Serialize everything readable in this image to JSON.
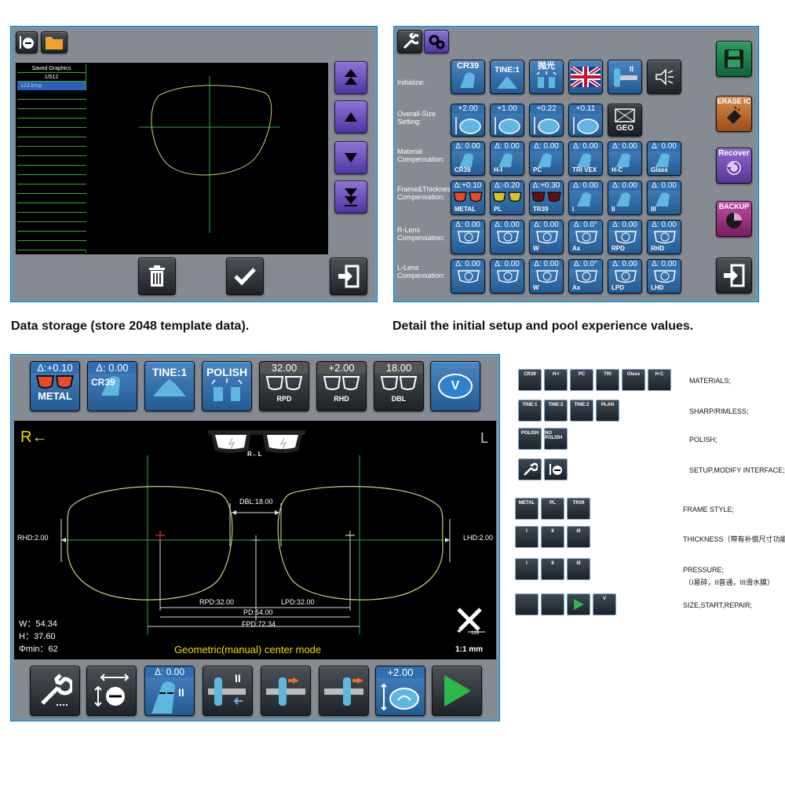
{
  "storage_panel": {
    "list_title": "Saved Graphics",
    "list_count": "1/512",
    "list_selected": "123.bmp",
    "caption": "Data storage (store 2048 template data)."
  },
  "setup_panel": {
    "caption": "Detail the initial setup and pool experience values.",
    "rows": [
      {
        "label": "Initialize:"
      },
      {
        "label": "Overall-Size Setting:",
        "values": [
          "+2.00",
          "+1.00",
          "+0.22",
          "+0.11"
        ],
        "geo": "GEO"
      },
      {
        "label": "Material Compensation:",
        "values": [
          "Δ: 0.00",
          "Δ: 0.00",
          "Δ: 0.00",
          "Δ: 0.00",
          "Δ: 0.00",
          "Δ: 0.00"
        ],
        "names": [
          "CR39",
          "H-I",
          "PC",
          "TRI VEX",
          "H-C",
          "Glass"
        ]
      },
      {
        "label": "Frame&Thickness Compensation:",
        "values": [
          "Δ:+0.10",
          "Δ:-0.20",
          "Δ:+0.30",
          "Δ: 0.00",
          "Δ: 0.00",
          "Δ: 0.00"
        ],
        "names": [
          "METAL",
          "PL",
          "TR39",
          "I",
          "II",
          "III"
        ]
      },
      {
        "label": "R-Lens Compensation:",
        "values": [
          "Δ: 0.00",
          "Δ: 0.00",
          "Δ: 0.00",
          "Δ: 0.0°",
          "Δ: 0.00",
          "Δ: 0.00"
        ],
        "names": [
          "",
          "",
          "W",
          "Ax",
          "RPD",
          "RHD"
        ]
      },
      {
        "label": "L-Lens Compensation:",
        "values": [
          "Δ: 0.00",
          "Δ: 0.00",
          "Δ: 0.00",
          "Δ: 0.0°",
          "Δ: 0.00",
          "Δ: 0.00"
        ],
        "names": [
          "",
          "",
          "W",
          "Ax",
          "LPD",
          "LHD"
        ]
      }
    ],
    "init_labels": [
      "CR39",
      "TINE:1",
      "抛光"
    ],
    "side_buttons": [
      "ERASE IC",
      "Recover",
      "BACKUP"
    ]
  },
  "main_panel": {
    "top_buttons": [
      {
        "value": "Δ:+0.10",
        "name": "METAL"
      },
      {
        "value": "Δ: 0.00",
        "name": "CR39"
      },
      {
        "value": "",
        "name": "TINE:1"
      },
      {
        "value": "",
        "name": "POLISH"
      },
      {
        "value": "32.00",
        "name": "RPD"
      },
      {
        "value": "+2.00",
        "name": "RHD"
      },
      {
        "value": "18.00",
        "name": "DBL"
      }
    ],
    "v_label": "V",
    "r_indicator": "R←",
    "l_indicator": "L",
    "glasses_label": "R←L",
    "dbl": "DBL:18.00",
    "rhd": "RHD:2.00",
    "lhd": "LHD:2.00",
    "rpd": "RPD:32.00",
    "lpd": "LPD:32.00",
    "pd": "PD:64.00",
    "fpd": "FPD:72.34",
    "w": "W：54.34",
    "h": "H：37.60",
    "phi": "Φmin：62",
    "mode": "Geometric(manual) center mode",
    "scale_num": "128",
    "scale": "1:1 mm",
    "bottom_buttons": [
      {
        "value": "Δ: 0.00",
        "name": "II"
      },
      {
        "value": "+2.00",
        "name": ""
      }
    ]
  },
  "legend": {
    "rows": [
      {
        "icons": [
          "CR39",
          "H-I",
          "PC",
          "TRI",
          "Glass",
          "H-C"
        ],
        "text": "MATERIALS;"
      },
      {
        "icons": [
          "TINE:1",
          "TINE:2",
          "TINE:2",
          "PLAN"
        ],
        "text": "SHARP/RIMLESS;"
      },
      {
        "icons": [
          "POLISH",
          "NO POLISH"
        ],
        "text": "POLISH;"
      },
      {
        "icons": [
          "",
          ""
        ],
        "text": "SETUP,MODIFY INTERFACE;"
      },
      {
        "icons": [
          "METAL",
          "PL",
          "TR39"
        ],
        "text": "FRAME STYLE;"
      },
      {
        "icons": [
          "I",
          "II",
          "III"
        ],
        "text": "THICKNESS（带有补偿尺寸功能）;"
      },
      {
        "icons": [
          "I",
          "II",
          "III"
        ],
        "text": "PRESSURE;"
      },
      {
        "icons": [],
        "text": "（I易碎，II普通，III滑水膜）"
      },
      {
        "icons": [
          "",
          "",
          "",
          "V"
        ],
        "text": "SIZE,START,REPAIR;"
      }
    ]
  },
  "colors": {
    "frame_border": "#4fa3d6",
    "panel_gray": "#858b91",
    "lens_outline": "#c8d27a",
    "guide_green": "#2fa84a",
    "start_green": "#2fb84a",
    "value_blue": "#2f6fb0"
  }
}
